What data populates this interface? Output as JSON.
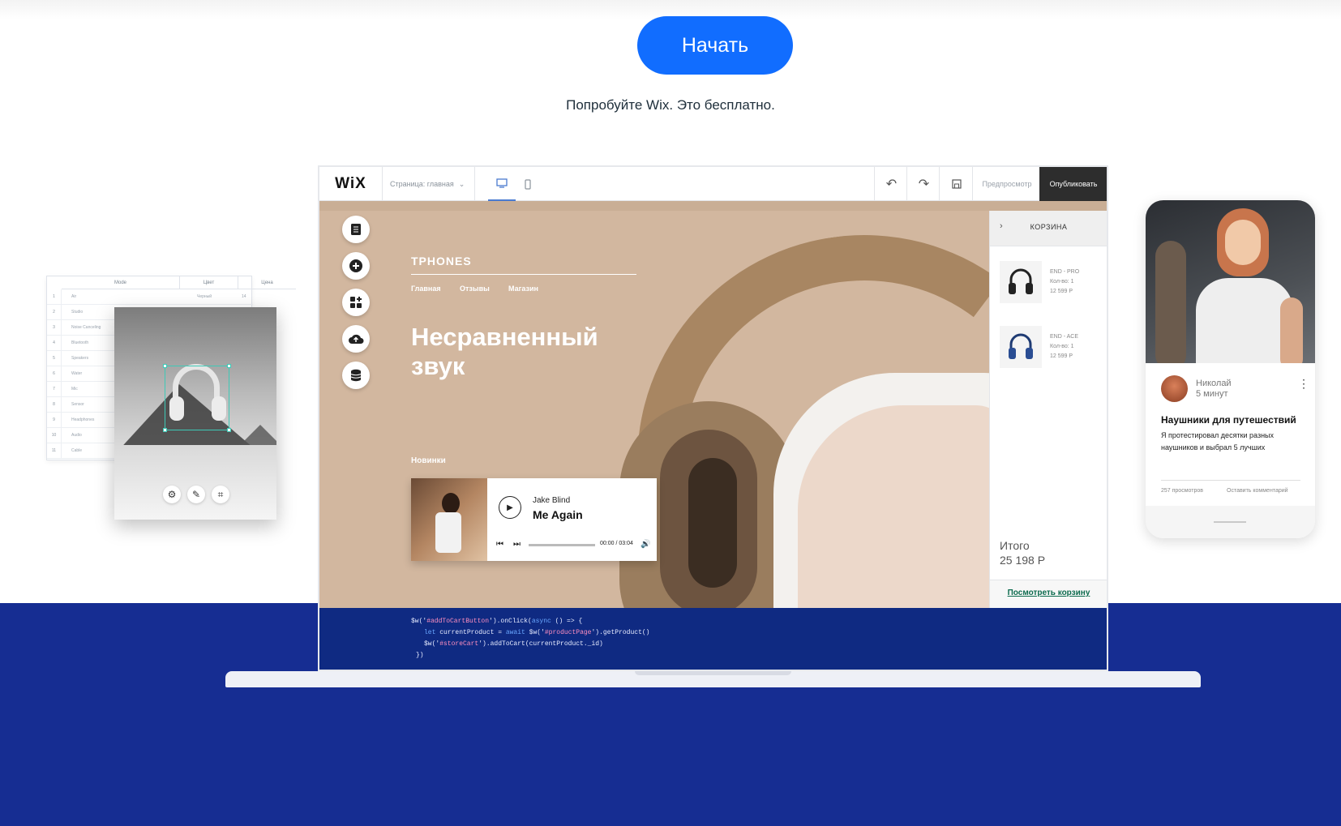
{
  "hero": {
    "cta_label": "Начать",
    "tagline": "Попробуйте Wix. Это бесплатно."
  },
  "editor": {
    "logo": "WiX",
    "page_selector": "Страница: главная",
    "preview": "Предпросмотр",
    "publish": "Опубликовать"
  },
  "site": {
    "brand": "TPHONES",
    "nav": [
      "Главная",
      "Отзывы",
      "Магазин"
    ],
    "headline": "Несравненный звук",
    "new_label": "Новинки"
  },
  "player": {
    "artist": "Jake Blind",
    "track": "Me Again",
    "time": "00:00 / 03:04"
  },
  "cart": {
    "title": "КОРЗИНА",
    "items": [
      {
        "name": "END - PRO",
        "qty": "Кол-во: 1",
        "price": "12 599 Р"
      },
      {
        "name": "END - ACE",
        "qty": "Кол-во: 1",
        "price": "12 599 Р"
      }
    ],
    "total_label": "Итого",
    "total_value": "25 198 Р",
    "view_link": "Посмотреть корзину"
  },
  "code": {
    "l1a": "$w('",
    "l1b": "#addToCartButton",
    "l1c": "').onClick(",
    "l1d": "async",
    "l1e": " () => {",
    "l2a": "let",
    "l2b": " currentProduct = ",
    "l2c": "await",
    "l2d": " $w('",
    "l2e": "#productPage",
    "l2f": "').getProduct()",
    "l3a": "$w('",
    "l3b": "#storeCart",
    "l3c": "').addToCart(currentProduct._id)",
    "l4": "})"
  },
  "table_card": {
    "headers": [
      "Mode",
      "Цвет",
      "Цена"
    ],
    "rows": [
      {
        "n": "1",
        "m": "Air",
        "c": "Черный",
        "p": "14 999 Р"
      },
      {
        "n": "2",
        "m": "Studio",
        "c": "",
        "p": ""
      },
      {
        "n": "3",
        "m": "Noise Canceling",
        "c": "",
        "p": ""
      },
      {
        "n": "4",
        "m": "Bluetooth",
        "c": "",
        "p": ""
      },
      {
        "n": "5",
        "m": "Speakers",
        "c": "",
        "p": ""
      },
      {
        "n": "6",
        "m": "Water",
        "c": "",
        "p": ""
      },
      {
        "n": "7",
        "m": "Mic",
        "c": "",
        "p": ""
      },
      {
        "n": "8",
        "m": "Sensor",
        "c": "",
        "p": ""
      },
      {
        "n": "9",
        "m": "Headphones",
        "c": "",
        "p": ""
      },
      {
        "n": "10",
        "m": "Audio",
        "c": "",
        "p": ""
      },
      {
        "n": "11",
        "m": "Cable",
        "c": "",
        "p": ""
      }
    ]
  },
  "phone": {
    "author": "Николай",
    "read_time": "5 минут",
    "title": "Наушники для путешествий",
    "text": "Я протестировал десятки разных наушников и выбрал 5 лучших",
    "views": "257 просмотров",
    "comment": "Оставить комментарий"
  },
  "colors": {
    "cta_blue": "#116dff",
    "band_blue": "#162d92",
    "canvas_tan": "#d2b79f"
  }
}
